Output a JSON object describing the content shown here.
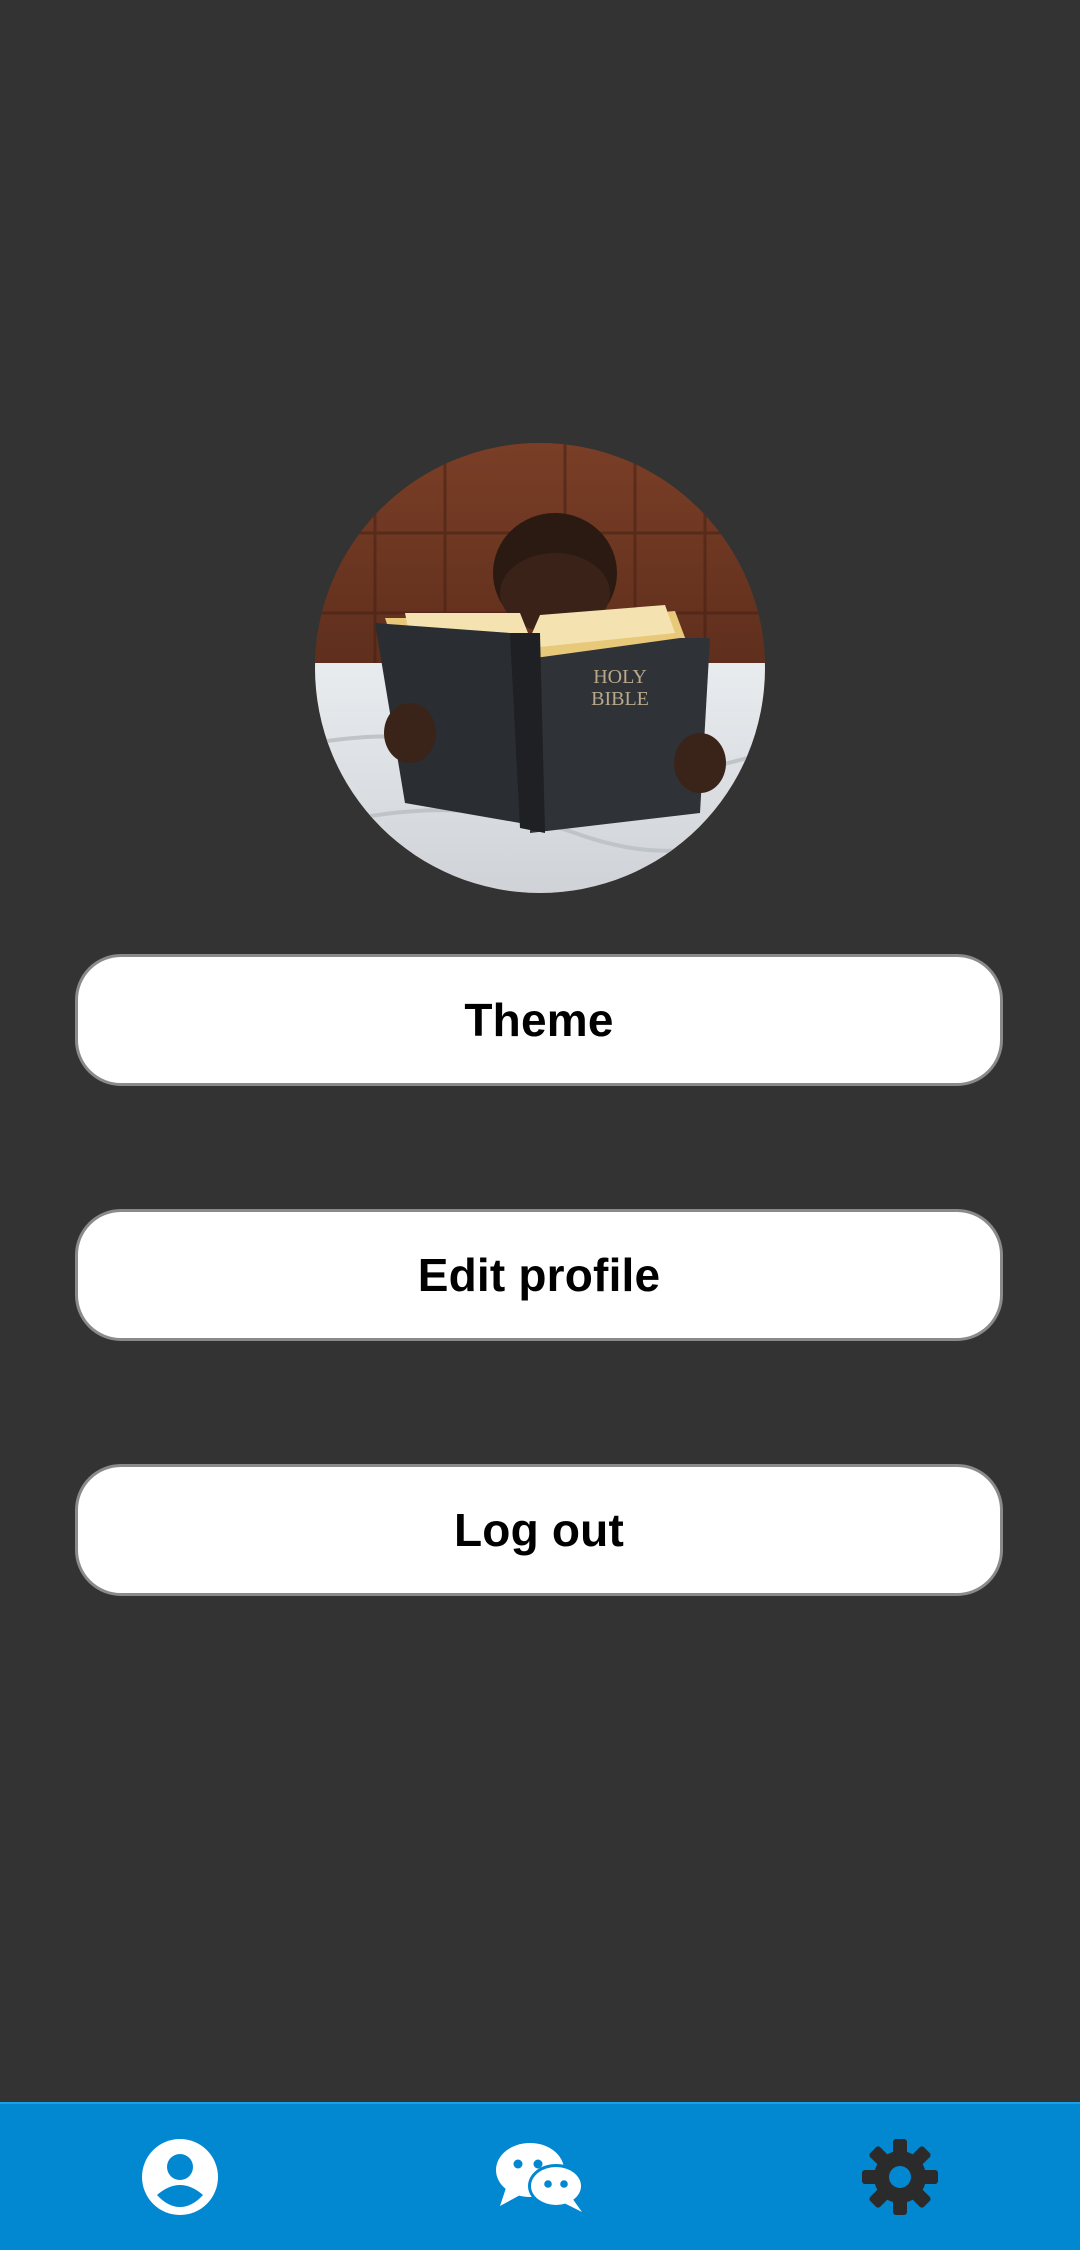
{
  "profile": {
    "avatar_caption": "HOLY BIBLE"
  },
  "menu": {
    "theme_label": "Theme",
    "edit_profile_label": "Edit profile",
    "logout_label": "Log out"
  },
  "bottom_nav": {
    "items": [
      {
        "icon": "person-icon",
        "active": true
      },
      {
        "icon": "chat-bubbles-icon",
        "active": false
      },
      {
        "icon": "gear-icon",
        "active": false
      }
    ]
  },
  "colors": {
    "background": "#333333",
    "nav_bar": "#0288d1",
    "button_bg": "#ffffff",
    "button_border": "#8a8a8a",
    "active_icon": "#ffffff",
    "inactive_icon": "#2b2b2b"
  }
}
